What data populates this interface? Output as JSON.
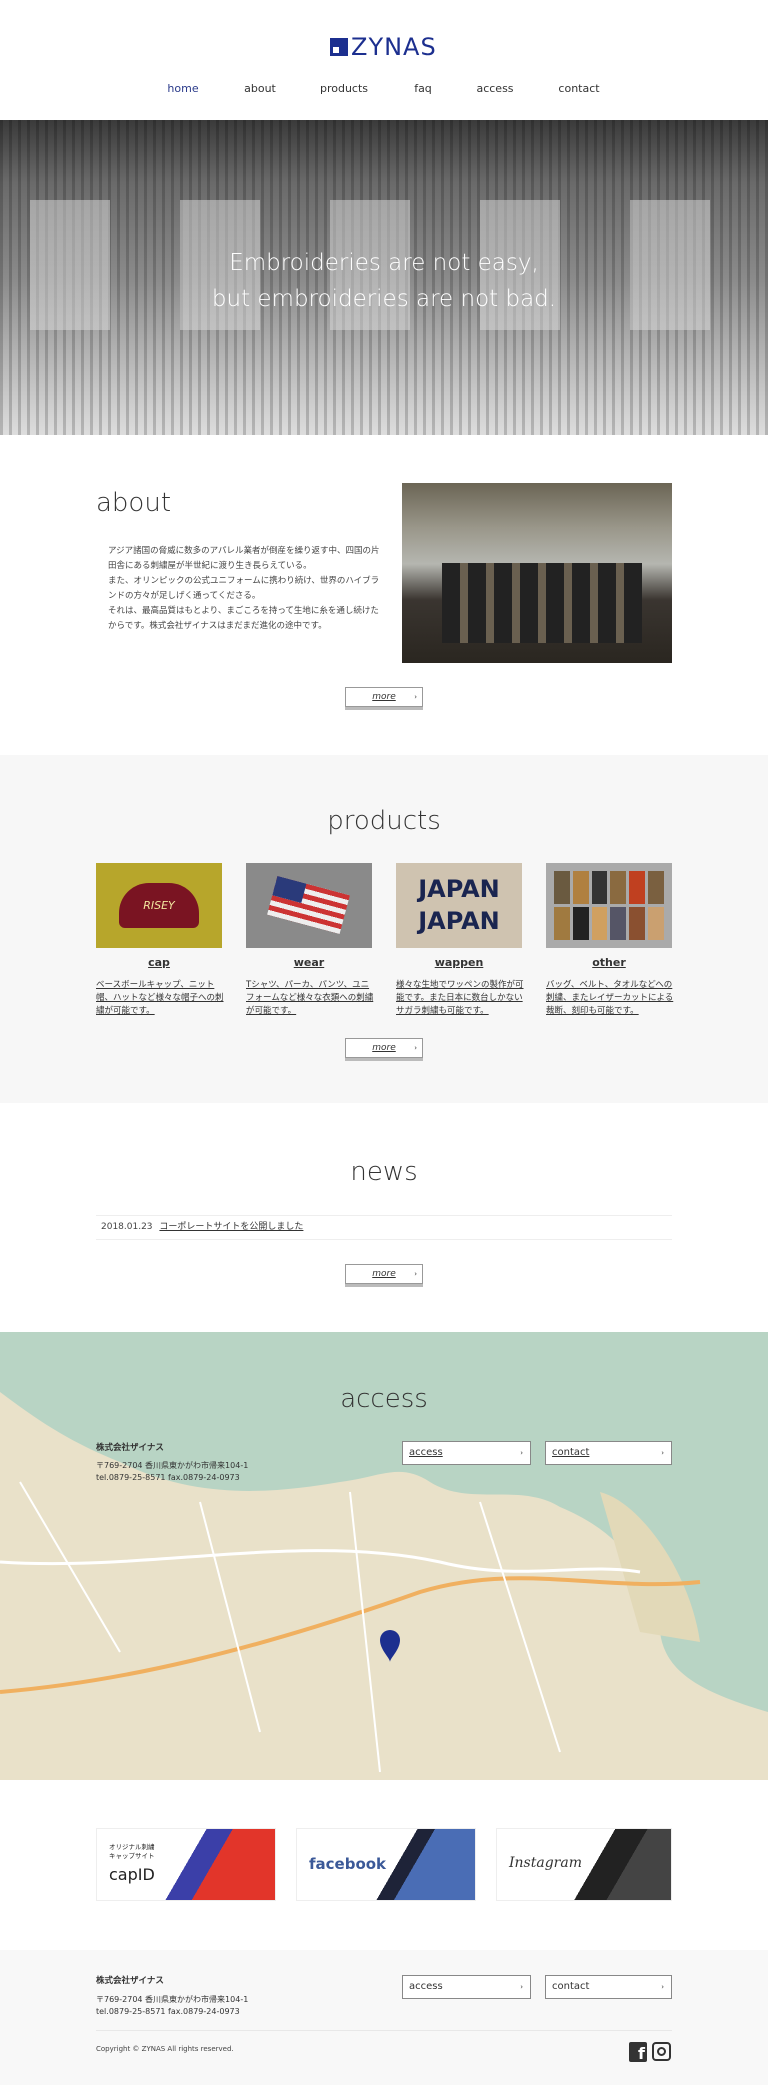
{
  "header": {
    "logo": "ZYNAS",
    "brand_color": "#1c2f8f",
    "nav": [
      {
        "label": "home",
        "active": true
      },
      {
        "label": "about"
      },
      {
        "label": "products"
      },
      {
        "label": "faq"
      },
      {
        "label": "access"
      },
      {
        "label": "contact"
      }
    ]
  },
  "hero": {
    "line1": "Embroideries are not easy,",
    "line2": "but embroideries are not bad."
  },
  "about": {
    "title": "about",
    "lines": [
      "アジア諸国の脅威に数多のアパレル業者が倒産を繰り返す中、四国の片",
      "田舎にある刺繍屋が半世紀に渡り生き長らえている。",
      "また、オリンピックの公式ユニフォームに携わり続け、世界のハイブラ",
      "ンドの方々が足しげく通ってくださる。",
      "それは、最高品質はもとより、まごころを持って生地に糸を通し続けた",
      "からです。株式会社ザイナスはまだまだ進化の途中です。"
    ],
    "more": "more"
  },
  "products": {
    "title": "products",
    "more": "more",
    "items": [
      {
        "title": "cap",
        "desc": "ベースボールキャップ、ニット帽、ハットなど様々な帽子への刺繍が可能です。",
        "image_text": "RISEY"
      },
      {
        "title": "wear",
        "desc": "Tシャツ、パーカ、パンツ、ユニフォームなど様々な衣類への刺繍が可能です。"
      },
      {
        "title": "wappen",
        "desc": "様々な生地でワッペンの製作が可能です。また日本に数台しかないサガラ刺繍も可能です。",
        "image_text": "JAPAN"
      },
      {
        "title": "other",
        "desc": "バッグ、ベルト、タオルなどへの刺繍、またレイザーカットによる裁断、刻印も可能です。"
      }
    ]
  },
  "news": {
    "title": "news",
    "items": [
      {
        "date": "2018.01.23",
        "text": "コーポレートサイトを公開しました"
      }
    ],
    "more": "more"
  },
  "access": {
    "title": "access",
    "company": "株式会社ザイナス",
    "address": "〒769-2704 香川県東かがわ市帰来104-1",
    "tel": "tel.0879-25-8571 fax.0879-24-0973",
    "buttons": [
      "access",
      "contact"
    ],
    "bg_color": "#b8d4c4"
  },
  "banners": [
    {
      "label": "capID",
      "sub": "オリジナル刺繍キャップサイト"
    },
    {
      "label": "facebook"
    },
    {
      "label": "Instagram"
    }
  ],
  "footer": {
    "company": "株式会社ザイナス",
    "address": "〒769-2704 香川県東かがわ市帰来104-1",
    "tel": "tel.0879-25-8571 fax.0879-24-0973",
    "buttons": [
      "access",
      "contact"
    ],
    "copyright": "Copyright © ZYNAS All rights reserved."
  }
}
